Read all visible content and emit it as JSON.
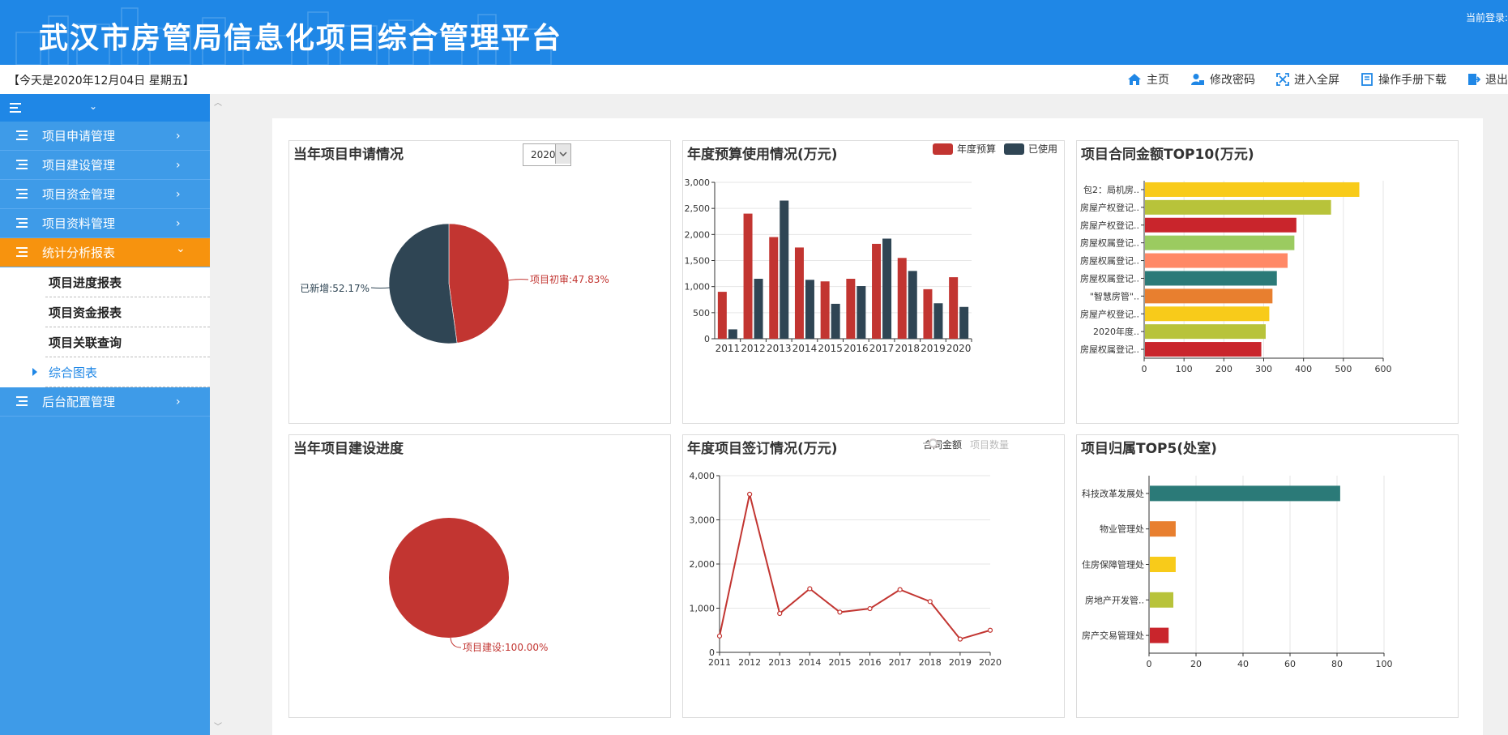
{
  "app": {
    "title": "武汉市房管局信息化项目综合管理平台",
    "login_label": "当前登录:"
  },
  "infobar": {
    "date_text": "【今天是2020年12月04日 星期五】"
  },
  "topnav": [
    {
      "label": "主页",
      "icon": "home-icon"
    },
    {
      "label": "修改密码",
      "icon": "user-lock-icon"
    },
    {
      "label": "进入全屏",
      "icon": "fullscreen-icon"
    },
    {
      "label": "操作手册下载",
      "icon": "book-icon"
    },
    {
      "label": "退出",
      "icon": "logout-icon"
    }
  ],
  "sidebar": {
    "items": [
      {
        "label": "项目申请管理",
        "arrow": "›"
      },
      {
        "label": "项目建设管理",
        "arrow": "›"
      },
      {
        "label": "项目资金管理",
        "arrow": "›"
      },
      {
        "label": "项目资料管理",
        "arrow": "›"
      },
      {
        "label": "统计分析报表",
        "arrow": "⌄",
        "active": true
      },
      {
        "label": "后台配置管理",
        "arrow": "›"
      }
    ],
    "subitems": [
      "项目进度报表",
      "项目资金报表",
      "项目关联查询",
      "综合图表"
    ]
  },
  "colors": {
    "header": "#1f87e6",
    "sidebar": "#3e9be8",
    "active": "#f7930e",
    "red": "#c23531",
    "navy": "#2f4554"
  },
  "charts": {
    "pie1": {
      "title": "当年项目申请情况",
      "year": "2020"
    },
    "bar1": {
      "title": "年度预算使用情况(万元)",
      "legend": [
        "年度预算",
        "已使用"
      ]
    },
    "hbar1": {
      "title": "项目合同金额TOP10(万元)"
    },
    "pie2": {
      "title": "当年项目建设进度"
    },
    "line1": {
      "title": "年度项目签订情况(万元)",
      "legend": [
        "合同金额",
        "项目数量"
      ]
    },
    "hbar2": {
      "title": "项目归属TOP5(处室)"
    }
  },
  "chart_data": [
    {
      "type": "pie",
      "title": "当年项目申请情况",
      "slices": [
        {
          "name": "项目初审",
          "value": 47.83,
          "label": "项目初审:47.83%",
          "color": "#c23531"
        },
        {
          "name": "已新增",
          "value": 52.17,
          "label": "已新增:52.17%",
          "color": "#2f4554"
        }
      ]
    },
    {
      "type": "bar",
      "title": "年度预算使用情况(万元)",
      "categories": [
        "2011",
        "2012",
        "2013",
        "2014",
        "2015",
        "2016",
        "2017",
        "2018",
        "2019",
        "2020"
      ],
      "series": [
        {
          "name": "年度预算",
          "color": "#c23531",
          "values": [
            900,
            2400,
            1950,
            1750,
            1100,
            1150,
            1820,
            1550,
            950,
            1180
          ]
        },
        {
          "name": "已使用",
          "color": "#2f4554",
          "values": [
            180,
            1150,
            2650,
            1130,
            670,
            1010,
            1920,
            1300,
            680,
            610
          ]
        }
      ],
      "ylim": [
        0,
        3000
      ],
      "yticks": [
        "0",
        "500",
        "1,000",
        "1,500",
        "2,000",
        "2,500",
        "3,000"
      ]
    },
    {
      "type": "bar",
      "orientation": "horizontal",
      "title": "项目合同金额TOP10(万元)",
      "categories": [
        "包2：局机房..",
        "房屋产权登记..",
        "房屋产权登记..",
        "房屋权属登记..",
        "房屋权属登记..",
        "房屋权属登记..",
        "\"智慧房管\"..",
        "房屋产权登记..",
        "2020年度..",
        "房屋权属登记.."
      ],
      "values": [
        538,
        467,
        380,
        375,
        358,
        331,
        320,
        312,
        303,
        292
      ],
      "colors": [
        "#f8cb1a",
        "#b8c33a",
        "#c9252c",
        "#9bcb60",
        "#ff8866",
        "#2b7a78",
        "#e87f2f",
        "#f8cb1a",
        "#b8c33a",
        "#c9252c"
      ],
      "xlim": [
        0,
        600
      ],
      "xticks": [
        "0",
        "100",
        "200",
        "300",
        "400",
        "500",
        "600"
      ]
    },
    {
      "type": "pie",
      "title": "当年项目建设进度",
      "slices": [
        {
          "name": "项目建设",
          "value": 100,
          "label": "项目建设:100.00%",
          "color": "#c23531"
        }
      ]
    },
    {
      "type": "line",
      "title": "年度项目签订情况(万元)",
      "x": [
        "2011",
        "2012",
        "2013",
        "2014",
        "2015",
        "2016",
        "2017",
        "2018",
        "2019",
        "2020"
      ],
      "series": [
        {
          "name": "合同金额",
          "color": "#c23531",
          "values": [
            370,
            3580,
            880,
            1440,
            910,
            990,
            1420,
            1150,
            300,
            500
          ]
        },
        {
          "name": "项目数量",
          "color": "#cccccc",
          "values": []
        }
      ],
      "ylim": [
        0,
        4000
      ],
      "yticks": [
        "0",
        "1,000",
        "2,000",
        "3,000",
        "4,000"
      ]
    },
    {
      "type": "bar",
      "orientation": "horizontal",
      "title": "项目归属TOP5(处室)",
      "categories": [
        "科技改革发展处",
        "物业管理处",
        "住房保障管理处",
        "房地产开发管..",
        "房产交易管理处"
      ],
      "values": [
        81,
        11,
        11,
        10,
        8
      ],
      "colors": [
        "#2b7a78",
        "#e87f2f",
        "#f8cb1a",
        "#b8c33a",
        "#c9252c"
      ],
      "xlim": [
        0,
        100
      ],
      "xticks": [
        "0",
        "20",
        "40",
        "60",
        "80",
        "100"
      ]
    }
  ]
}
